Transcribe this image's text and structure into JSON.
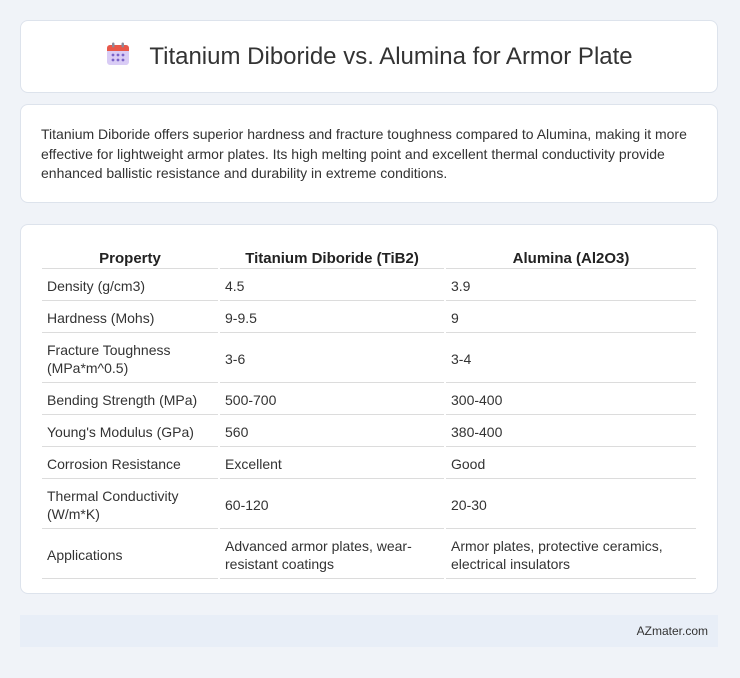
{
  "header": {
    "title": "Titanium Diboride vs. Alumina for Armor Plate",
    "icon": "calendar-icon",
    "icon_colors": {
      "top": "#e74c3c",
      "body": "#c9b8f0",
      "dots": "#7b63c9"
    }
  },
  "description": {
    "text": "Titanium Diboride offers superior hardness and fracture toughness compared to Alumina, making it more effective for lightweight armor plates. Its high melting point and excellent thermal conductivity provide enhanced ballistic resistance and durability in extreme conditions."
  },
  "table": {
    "headers": [
      "Property",
      "Titanium Diboride (TiB2)",
      "Alumina (Al2O3)"
    ],
    "rows": [
      [
        "Density (g/cm3)",
        "4.5",
        "3.9"
      ],
      [
        "Hardness (Mohs)",
        "9-9.5",
        "9"
      ],
      [
        "Fracture Toughness (MPa*m^0.5)",
        "3-6",
        "3-4"
      ],
      [
        "Bending Strength (MPa)",
        "500-700",
        "300-400"
      ],
      [
        "Young's Modulus (GPa)",
        "560",
        "380-400"
      ],
      [
        "Corrosion Resistance",
        "Excellent",
        "Good"
      ],
      [
        "Thermal Conductivity (W/m*K)",
        "60-120",
        "20-30"
      ],
      [
        "Applications",
        "Advanced armor plates, wear-resistant coatings",
        "Armor plates, protective ceramics, electrical insulators"
      ]
    ]
  },
  "footer": {
    "brand": "AZmater.com"
  }
}
